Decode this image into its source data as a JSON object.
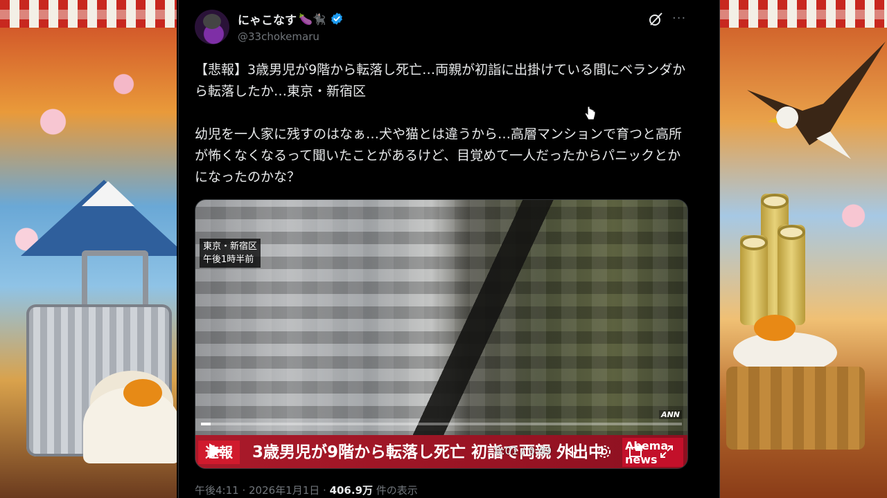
{
  "tweet": {
    "author": {
      "display_name": "にゃこなす",
      "name_emojis": "🍆🐈‍⬛",
      "handle": "@33chokemaru",
      "verified": true
    },
    "text": "【悲報】3歳男児が9階から転落し死亡…両親が初詣に出掛けている間にベランダから転落したか…東京・新宿区\n\n幼児を一人家に残すのはなぁ…犬や猫とは違うから…高層マンションで育つと高所が怖くなくなるって聞いたことがあるけど、目覚めて一人だったからパニックとかになったのかな？",
    "media": {
      "location_caption_line1": "東京・新宿区",
      "location_caption_line2": "午後1時半前",
      "broadcaster_mark": "ANN",
      "breaking_label": "速報",
      "headline": "3歳男児が9階から転落し死亡 初詣で両親 外出中",
      "time": "0:01 / 0:49",
      "progress_fraction": 0.02,
      "logo_text_line1": "Abema",
      "logo_text_line2": "news"
    },
    "meta": {
      "time_text": "午後4:11 · 2026年1月1日 · ",
      "views": "406.9万",
      "views_suffix": " 件の表示"
    }
  },
  "icons": {
    "verified": "verified-badge-icon",
    "grok": "grok-icon",
    "more": "more-icon",
    "play": "play-icon",
    "volume": "volume-icon",
    "settings": "settings-icon",
    "pip": "picture-in-picture-icon",
    "fullscreen": "fullscreen-icon"
  },
  "colors": {
    "background": "#000000",
    "text": "#e7e9ea",
    "secondary": "#71767b",
    "verified": "#1d9bf0",
    "ticker_red": "#aa1a2a"
  }
}
